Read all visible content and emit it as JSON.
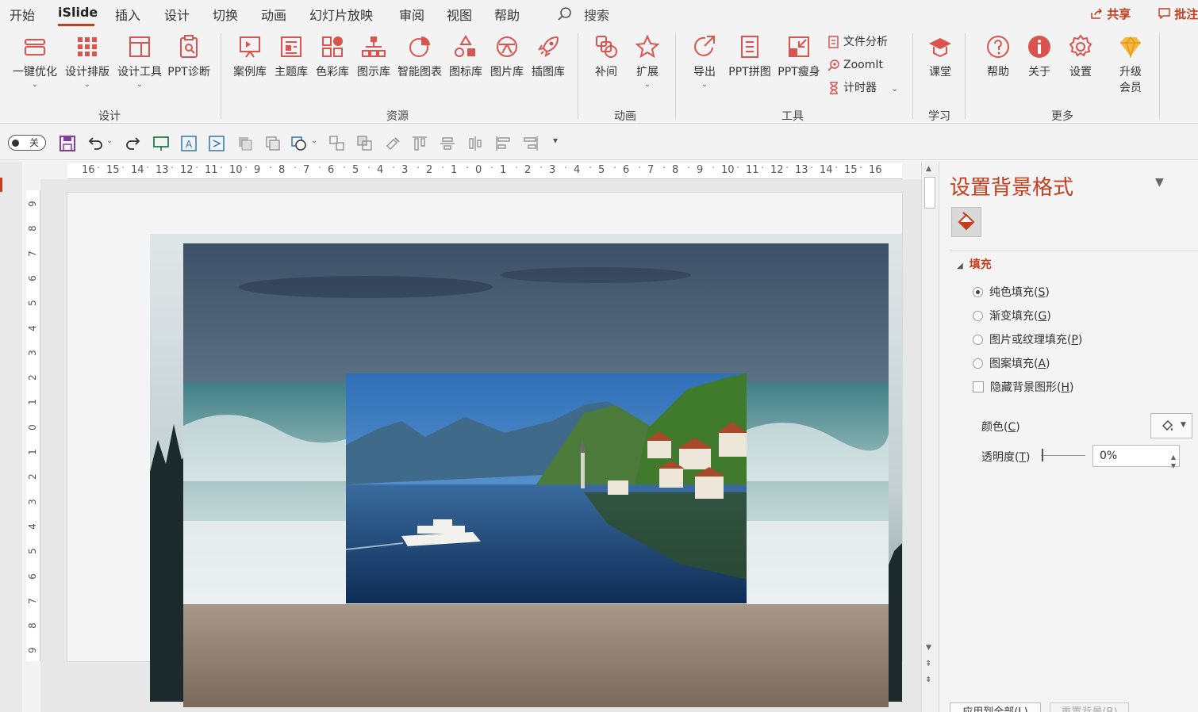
{
  "tabs": [
    "开始",
    "iSlide",
    "插入",
    "设计",
    "切换",
    "动画",
    "幻灯片放映",
    "审阅",
    "视图",
    "帮助"
  ],
  "active_tab": "iSlide",
  "search": {
    "label": "搜索"
  },
  "share_label": "共享",
  "comment_label": "批注",
  "ribbon": {
    "design": {
      "group": "设计",
      "items": [
        "一键优化",
        "设计排版",
        "设计工具",
        "PPT诊断"
      ]
    },
    "resources": {
      "group": "资源",
      "items": [
        "案例库",
        "主题库",
        "色彩库",
        "图示库",
        "智能图表",
        "图标库",
        "图片库",
        "插图库"
      ]
    },
    "animation": {
      "group": "动画",
      "items": [
        "补间",
        "扩展"
      ]
    },
    "tools": {
      "group": "工具",
      "items": [
        "导出",
        "PPT拼图",
        "PPT瘦身"
      ],
      "small": [
        "文件分析",
        "ZoomIt",
        "计时器"
      ]
    },
    "learning": {
      "group": "学习",
      "items": [
        "课堂"
      ]
    },
    "more": {
      "group": "更多",
      "items": [
        "帮助",
        "关于",
        "设置"
      ],
      "upgrade_line1": "升级",
      "upgrade_line2": "会员"
    }
  },
  "toggle_label": "关",
  "ruler_h": [
    "16",
    "15",
    "14",
    "13",
    "12",
    "11",
    "10",
    "9",
    "8",
    "7",
    "6",
    "5",
    "4",
    "3",
    "2",
    "1",
    "0",
    "1",
    "2",
    "3",
    "4",
    "5",
    "6",
    "7",
    "8",
    "9",
    "10",
    "11",
    "12",
    "13",
    "14",
    "15",
    "16"
  ],
  "ruler_v": [
    "9",
    "8",
    "7",
    "6",
    "5",
    "4",
    "3",
    "2",
    "1",
    "0",
    "1",
    "2",
    "3",
    "4",
    "5",
    "6",
    "7",
    "8",
    "9"
  ],
  "panel": {
    "title": "设置背景格式",
    "fill_header": "填充",
    "options": [
      {
        "label": "纯色填充",
        "key": "S",
        "selected": true
      },
      {
        "label": "渐变填充",
        "key": "G",
        "selected": false
      },
      {
        "label": "图片或纹理填充",
        "key": "P",
        "selected": false
      },
      {
        "label": "图案填充",
        "key": "A",
        "selected": false
      }
    ],
    "hide_bg": {
      "label": "隐藏背景图形",
      "key": "H",
      "checked": false
    },
    "color_label": "颜色",
    "color_key": "C",
    "transparency_label": "透明度",
    "transparency_key": "T",
    "transparency_value": "0%",
    "apply_all": "应用到全部(L)",
    "reset_bg": "重置背景(B)"
  },
  "colors": {
    "accent": "#c43e1c",
    "ribbon_bg": "#f3f3f3"
  }
}
